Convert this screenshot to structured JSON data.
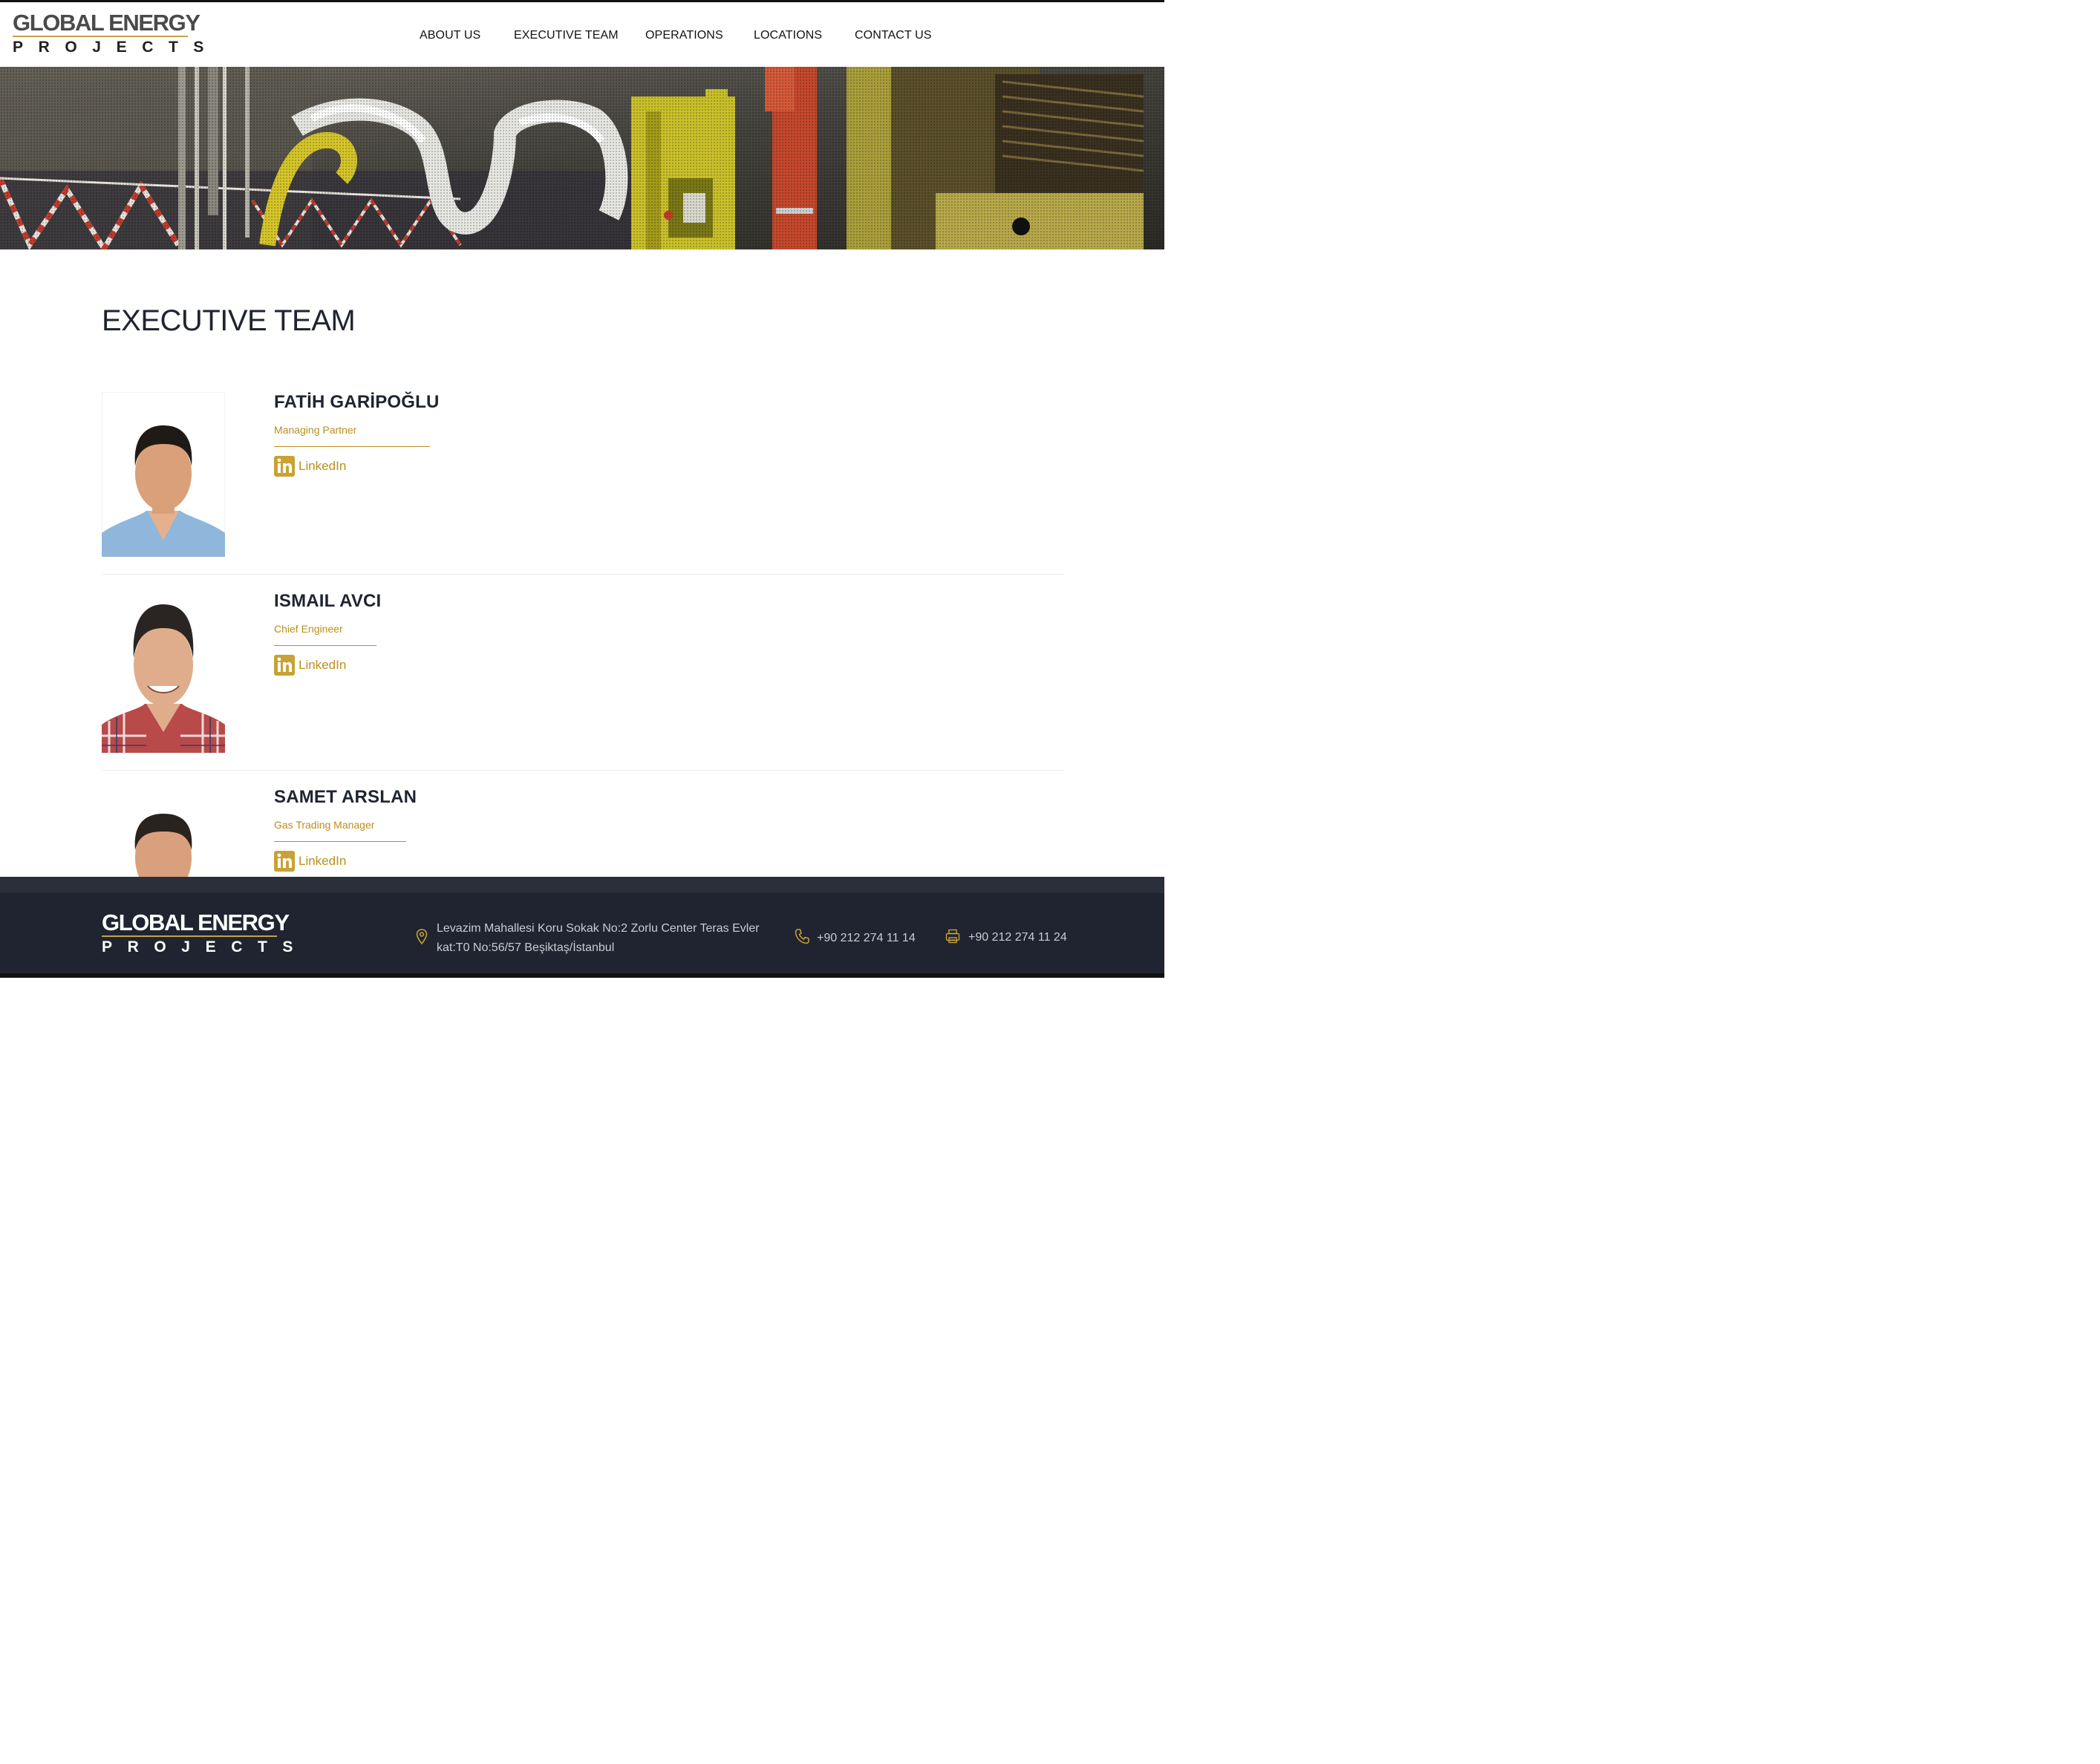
{
  "brand": {
    "line1": "GLOBAL ENERGY",
    "line2": "PROJECTS",
    "accent_color": "#c4a24a"
  },
  "nav": {
    "items": [
      {
        "label": "ABOUT US"
      },
      {
        "label": "EXECUTIVE TEAM"
      },
      {
        "label": "OPERATIONS"
      },
      {
        "label": "LOCATIONS"
      },
      {
        "label": "CONTACT US"
      }
    ]
  },
  "hero": {
    "image": "underground mining drill rig photo"
  },
  "page": {
    "title": "EXECUTIVE TEAM"
  },
  "team": [
    {
      "name": "FATİH GARİPOĞLU",
      "role": "Managing Partner",
      "link_label": "LinkedIn",
      "link_icon": "linkedin-icon"
    },
    {
      "name": "ISMAIL AVCI",
      "role": "Chief Engineer",
      "link_label": "LinkedIn",
      "link_icon": "linkedin-icon"
    },
    {
      "name": "SAMET ARSLAN",
      "role": "Gas Trading Manager",
      "link_label": "LinkedIn",
      "link_icon": "linkedin-icon"
    }
  ],
  "footer": {
    "address_line1": "Levazim Mahallesi Koru Sokak No:2 Zorlu Center Teras Evler",
    "address_line2": "kat:T0 No:56/57 Beşiktaş/İstanbul",
    "phone": "+90 212 274 11 14",
    "fax": "+90 212 274 11 24",
    "address_icon": "map-pin-icon",
    "phone_icon": "phone-icon",
    "fax_icon": "fax-icon"
  }
}
